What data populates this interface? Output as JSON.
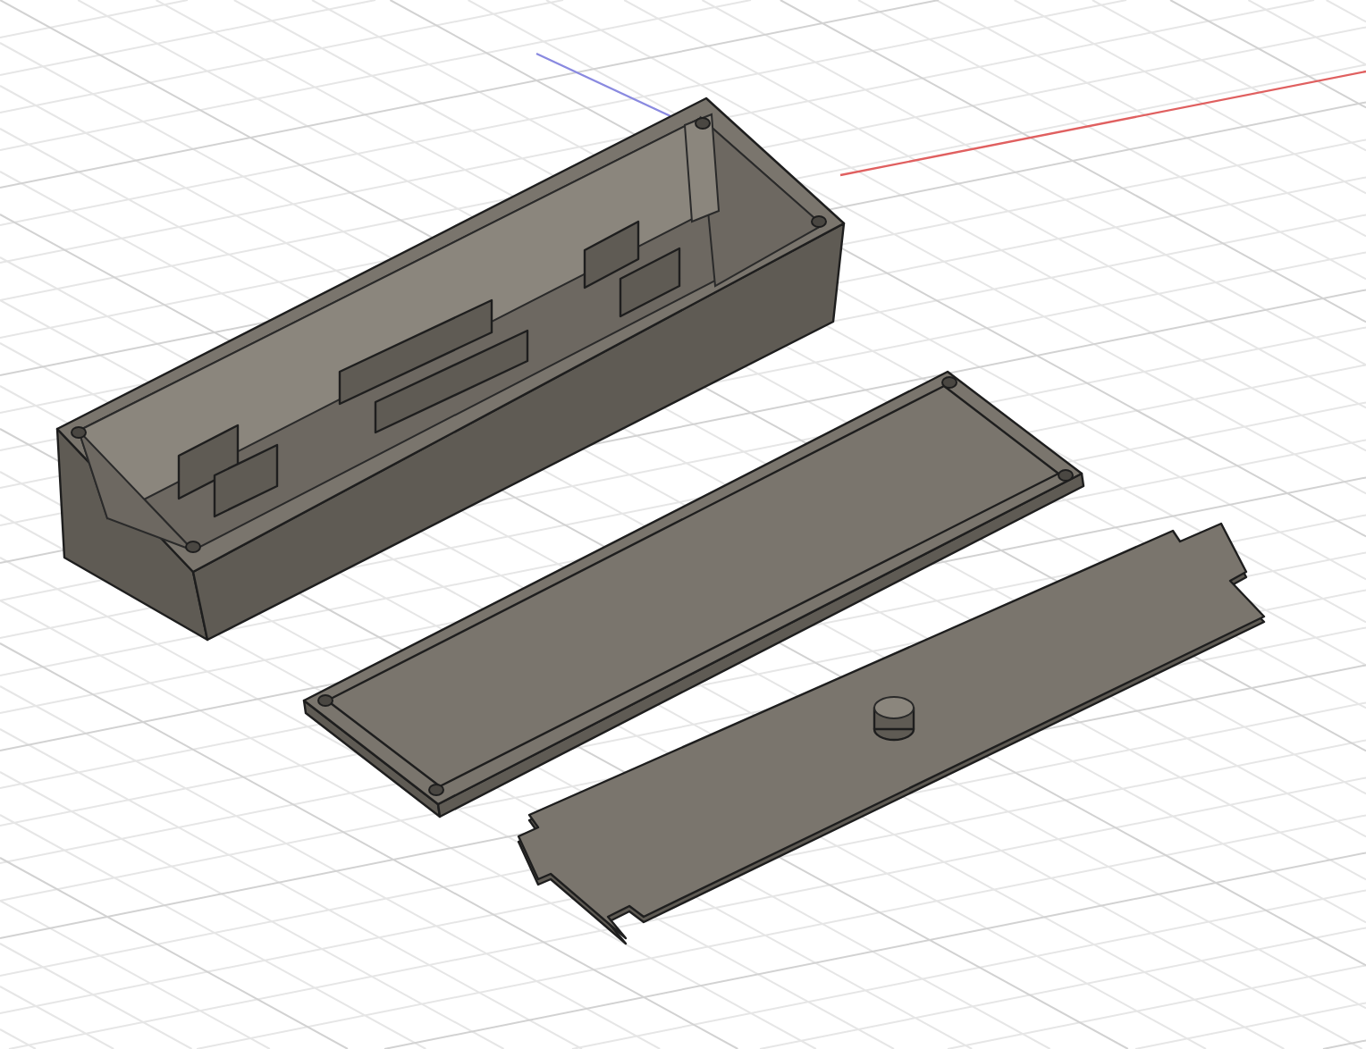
{
  "viewport": {
    "grid": true,
    "axes": true
  },
  "parts": [
    {
      "kind": "enclosure"
    },
    {
      "kind": "lid"
    },
    {
      "kind": "plate"
    }
  ]
}
